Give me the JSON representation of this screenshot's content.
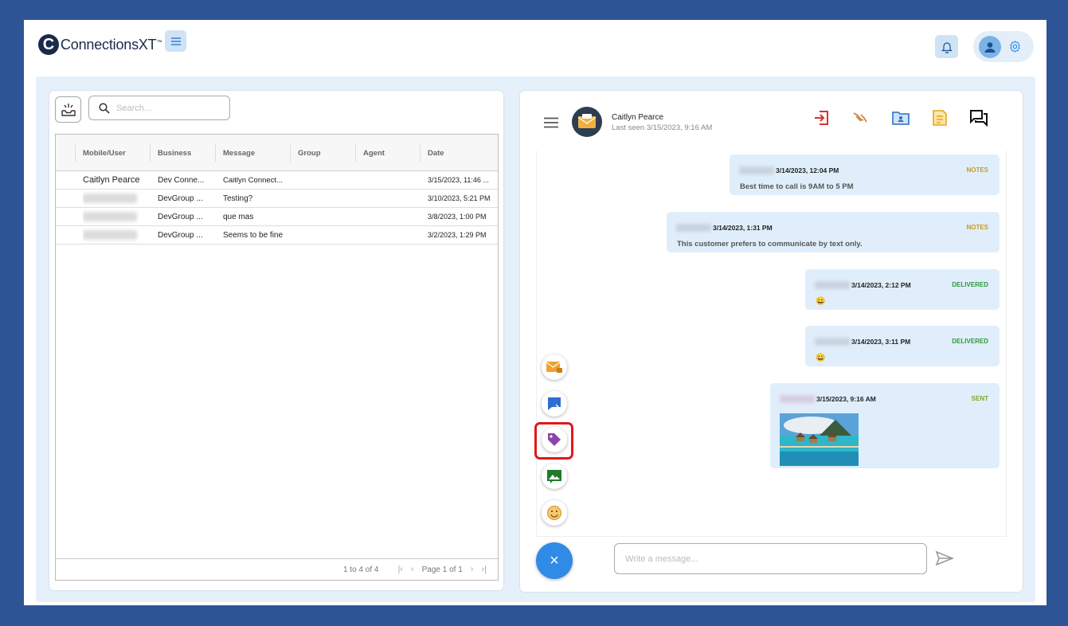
{
  "app": {
    "logo_letter": "C",
    "logo_name": "Connections",
    "logo_suffix": "XT",
    "logo_tm": "™"
  },
  "header": {
    "menu_icon": "hamburger-icon",
    "bell_icon": "bell-icon",
    "user_icon": "user-icon",
    "settings_icon": "gear-icon"
  },
  "search": {
    "placeholder": "Search..."
  },
  "table": {
    "columns": [
      "Mobile/User",
      "Business",
      "Message",
      "Group",
      "Agent",
      "Date"
    ],
    "rows": [
      {
        "user": "Caitlyn Pearce",
        "business": "Dev Conne...",
        "message": "Caitlyn Connect...",
        "group": "",
        "agent": "",
        "date": "3/15/2023, 11:46 ..."
      },
      {
        "user": "",
        "business": "DevGroup ...",
        "message": "Testing?",
        "group": "",
        "agent": "",
        "date": "3/10/2023, 5:21 PM"
      },
      {
        "user": "",
        "business": "DevGroup ...",
        "message": "que mas",
        "group": "",
        "agent": "",
        "date": "3/8/2023, 1:00 PM"
      },
      {
        "user": "",
        "business": "DevGroup ...",
        "message": "Seems to be fine",
        "group": "",
        "agent": "",
        "date": "3/2/2023, 1:29 PM"
      }
    ],
    "footer": {
      "count": "1 to 4 of 4",
      "page": "Page 1 of 1"
    }
  },
  "chat": {
    "contact_name": "Caitlyn Pearce",
    "last_seen": "Last seen 3/15/2023, 9:16 AM",
    "toolbar_icons": [
      "exit-icon",
      "hands-icon",
      "contact-folder-icon",
      "notes-icon",
      "chat-icon"
    ],
    "messages": [
      {
        "time": "3/14/2023, 12:04 PM",
        "status": "NOTES",
        "status_color": "#c99a1e",
        "body": "Best time to call is 9AM to 5 PM"
      },
      {
        "time": "3/14/2023, 1:31 PM",
        "status": "NOTES",
        "status_color": "#c99a1e",
        "body": "This customer prefers to communicate by text only."
      },
      {
        "time": "3/14/2023, 2:12 PM",
        "status": "DELIVERED",
        "status_color": "#2e9b3a",
        "body": "😀"
      },
      {
        "time": "3/14/2023, 3:11 PM",
        "status": "DELIVERED",
        "status_color": "#2e9b3a",
        "body": "😀"
      },
      {
        "time": "3/15/2023, 9:16 AM",
        "status": "SENT",
        "status_color": "#7fa82a",
        "body": ""
      }
    ],
    "actions": [
      "email-lock-icon",
      "chat-bubble-icon",
      "tag-icon",
      "image-icon",
      "emoji-icon"
    ],
    "input_placeholder": "Write a message...",
    "close_label": "×"
  }
}
